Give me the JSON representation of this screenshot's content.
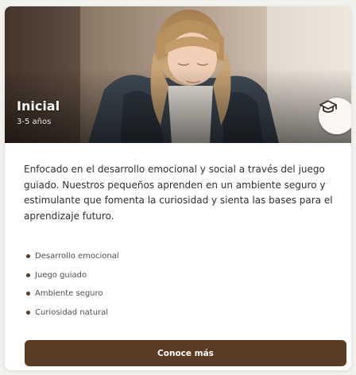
{
  "card": {
    "title": "Inicial",
    "age_range": "3-5 años",
    "badge_icon": "graduation-cap-icon",
    "description": "Enfocado en el desarrollo emocional y social a través del juego guiado. Nuestros pequeños aprenden en un ambiente seguro y estimulante que fomenta la curiosidad y sienta las bases para el aprendizaje futuro.",
    "features": [
      "Desarrollo emocional",
      "Juego guiado",
      "Ambiente seguro",
      "Curiosidad natural"
    ],
    "cta_label": "Conoce más"
  },
  "colors": {
    "accent": "#5b3b21",
    "bullet": "#5b3c24",
    "badge_bg": "#fbf6f1"
  }
}
